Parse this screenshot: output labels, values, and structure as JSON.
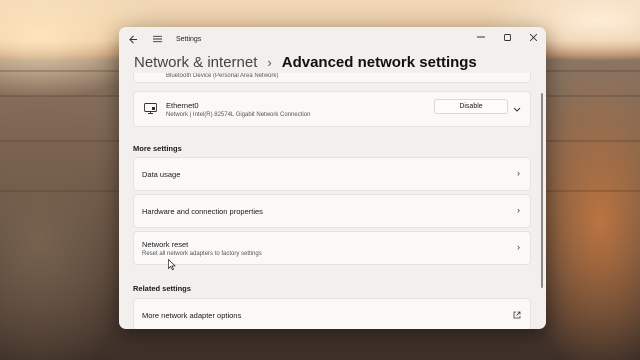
{
  "window": {
    "app_title": "Settings",
    "back_icon": "back-arrow-icon",
    "menu_icon": "hamburger-menu-icon",
    "controls": [
      "minimize-icon",
      "maximize-icon",
      "close-icon"
    ]
  },
  "breadcrumb": {
    "parent": "Network & internet",
    "separator": "›",
    "current": "Advanced network settings"
  },
  "adapters": [
    {
      "name": "",
      "description": "Bluetooth Device (Personal Area Network)"
    },
    {
      "name": "Ethernet0",
      "description": "Network | Intel(R) 82574L Gigabit Network Connection",
      "action_label": "Disable",
      "icon": "ethernet-monitor-icon"
    }
  ],
  "more_settings": {
    "heading": "More settings",
    "items": [
      {
        "title": "Data usage",
        "subtitle": ""
      },
      {
        "title": "Hardware and connection properties",
        "subtitle": ""
      },
      {
        "title": "Network reset",
        "subtitle": "Reset all network adapters to factory settings"
      }
    ]
  },
  "related_settings": {
    "heading": "Related settings",
    "items": [
      {
        "title": "More network adapter options",
        "icon": "external-link-icon"
      }
    ]
  },
  "colors": {
    "window_bg": "#f3efed",
    "card_bg": "#fbf9f8",
    "text": "#1a1a1a"
  }
}
